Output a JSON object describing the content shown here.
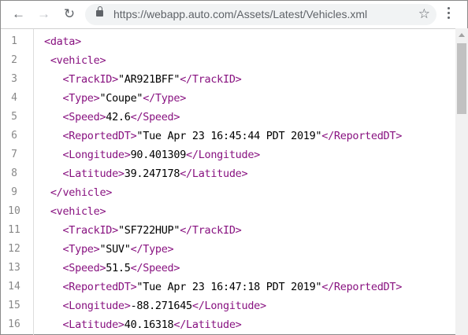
{
  "browser": {
    "url": "https://webapp.auto.com/Assets/Latest/Vehicles.xml",
    "icons": [
      "back-arrow-icon",
      "forward-arrow-icon",
      "reload-icon",
      "lock-icon",
      "star-icon",
      "kebab-menu-icon"
    ]
  },
  "colors": {
    "tag": "#881280",
    "text": "#000000"
  },
  "lines": [
    {
      "n": "1",
      "indent": "",
      "open": "<data>",
      "text": "",
      "close": ""
    },
    {
      "n": "2",
      "indent": " ",
      "open": "<vehicle>",
      "text": "",
      "close": ""
    },
    {
      "n": "3",
      "indent": "   ",
      "open": "<TrackID>",
      "text": "\"AR921BFF\"",
      "close": "</TrackID>"
    },
    {
      "n": "4",
      "indent": "   ",
      "open": "<Type>",
      "text": "\"Coupe\"",
      "close": "</Type>"
    },
    {
      "n": "5",
      "indent": "   ",
      "open": "<Speed>",
      "text": "42.6",
      "close": "</Speed>"
    },
    {
      "n": "6",
      "indent": "   ",
      "open": "<ReportedDT>",
      "text": "\"Tue Apr 23 16:45:44 PDT 2019\"",
      "close": "</ReportedDT>"
    },
    {
      "n": "7",
      "indent": "   ",
      "open": "<Longitude>",
      "text": "90.401309",
      "close": "</Longitude>"
    },
    {
      "n": "8",
      "indent": "   ",
      "open": "<Latitude>",
      "text": "39.247178",
      "close": "</Latitude>"
    },
    {
      "n": "9",
      "indent": " ",
      "open": "</vehicle>",
      "text": "",
      "close": ""
    },
    {
      "n": "10",
      "indent": " ",
      "open": "<vehicle>",
      "text": "",
      "close": ""
    },
    {
      "n": "11",
      "indent": "   ",
      "open": "<TrackID>",
      "text": "\"SF722HUP\"",
      "close": "</TrackID>"
    },
    {
      "n": "12",
      "indent": "   ",
      "open": "<Type>",
      "text": "\"SUV\"",
      "close": "</Type>"
    },
    {
      "n": "13",
      "indent": "   ",
      "open": "<Speed>",
      "text": "51.5",
      "close": "</Speed>"
    },
    {
      "n": "14",
      "indent": "   ",
      "open": "<ReportedDT>",
      "text": "\"Tue Apr 23 16:47:18 PDT 2019\"",
      "close": "</ReportedDT>"
    },
    {
      "n": "15",
      "indent": "   ",
      "open": "<Longitude>",
      "text": "-88.271645",
      "close": "</Longitude>"
    },
    {
      "n": "16",
      "indent": "   ",
      "open": "<Latitude>",
      "text": "40.16318",
      "close": "</Latitude>"
    }
  ]
}
